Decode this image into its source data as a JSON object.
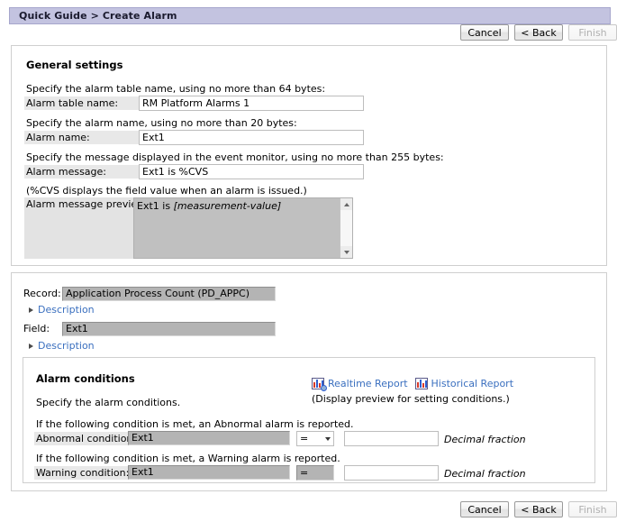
{
  "window": {
    "breadcrumb": "Quick Guide > Create Alarm"
  },
  "wizard_buttons": {
    "cancel": "Cancel",
    "back": "< Back",
    "finish": "Finish"
  },
  "general_settings": {
    "section_title": "General settings",
    "table_name_hint": "Specify the alarm table name, using no more than 64 bytes:",
    "table_name_label": "Alarm table name:",
    "table_name_value": "RM Platform Alarms 1",
    "alarm_name_hint": "Specify the alarm name, using no more than 20 bytes:",
    "alarm_name_label": "Alarm name:",
    "alarm_name_value": "Ext1",
    "message_hint": "Specify the message displayed in the event monitor, using no more than 255 bytes:",
    "message_label": "Alarm message:",
    "message_value": "Ext1 is %CVS",
    "message_note": "(%CVS displays the field value when an alarm is issued.)",
    "preview_label": "Alarm message preview:",
    "preview_prefix": "Ext1 is ",
    "preview_placeholder": "[measurement-value]"
  },
  "record_section": {
    "record_label": "Record:",
    "record_value": "Application Process Count (PD_APPC)",
    "record_description_link": "Description",
    "field_label": "Field:",
    "field_value": "Ext1",
    "field_description_link": "Description"
  },
  "alarm_conditions": {
    "section_title": "Alarm conditions",
    "instruction": "Specify the alarm conditions.",
    "realtime_report_link": "Realtime Report",
    "historical_report_link": "Historical Report",
    "report_note": "(Display preview for setting conditions.)",
    "abnormal_hint": "If the following condition is met, an Abnormal alarm is reported.",
    "abnormal_label": "Abnormal condition:",
    "abnormal_field": "Ext1",
    "abnormal_operator": "=",
    "abnormal_value": "",
    "abnormal_unit": "Decimal fraction",
    "warning_hint": "If the following condition is met, a Warning alarm is reported.",
    "warning_label": "Warning condition:",
    "warning_field": "Ext1",
    "warning_operator": "=",
    "warning_value": "",
    "warning_unit": "Decimal fraction"
  },
  "icons": {
    "realtime_report": "bar-chart-gear-icon",
    "historical_report": "bar-chart-icon",
    "expand": "triangle-right-icon",
    "scroll_up": "triangle-up-icon",
    "scroll_down": "triangle-down-icon",
    "dropdown": "chevron-down-icon"
  },
  "colors": {
    "titlebar": "#c3c3e0",
    "link": "#3a6fbf",
    "readonly_field": "#b4b4b4",
    "label_strip": "#e8e8e8"
  }
}
